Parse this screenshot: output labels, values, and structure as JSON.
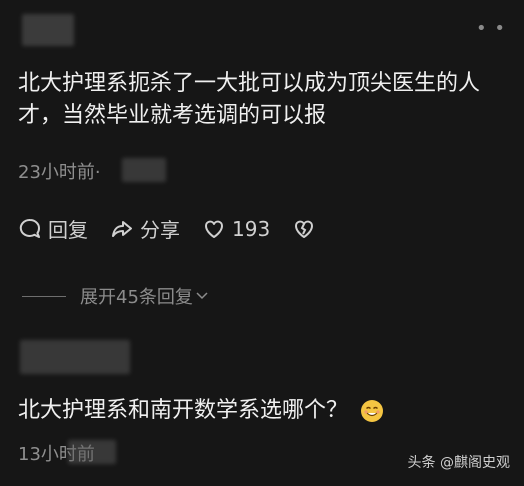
{
  "comment1": {
    "text": "北大护理系扼杀了一大批可以成为顶尖医生的人才，当然毕业就考选调的可以报",
    "time": "23小时前·",
    "actions": {
      "reply_label": "回复",
      "share_label": "分享",
      "like_count": "193"
    }
  },
  "expand_label": "展开45条回复",
  "comment2": {
    "text": "北大护理系和南开数学系选哪个？",
    "time": "13小时前"
  },
  "watermark": "头条 @麒阁史观"
}
